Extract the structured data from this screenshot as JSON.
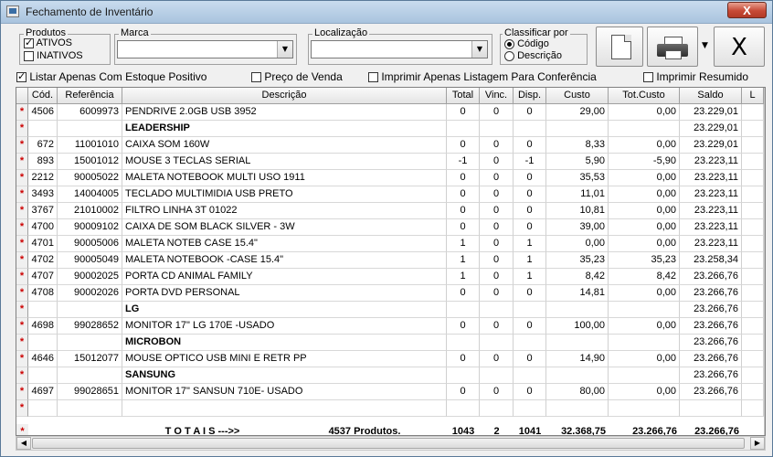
{
  "window": {
    "title": "Fechamento de Inventário",
    "close_label": "X"
  },
  "produtos": {
    "legend": "Produtos",
    "ativos_label": "ATIVOS",
    "ativos_checked": true,
    "inativos_label": "INATIVOS",
    "inativos_checked": false
  },
  "marca": {
    "legend": "Marca",
    "value": ""
  },
  "localizacao": {
    "legend": "Localização",
    "value": ""
  },
  "classificar": {
    "legend": "Classificar por",
    "codigo_label": "Código",
    "descricao_label": "Descrição",
    "selected": "codigo"
  },
  "toolbar": {
    "close_label": "X"
  },
  "options": {
    "estoque_positivo": {
      "label": "Listar Apenas Com Estoque Positivo",
      "checked": true
    },
    "preco_venda": {
      "label": "Preço de Venda",
      "checked": false
    },
    "imprimir_conferencia": {
      "label": "Imprimir Apenas Listagem Para Conferência",
      "checked": false
    },
    "imprimir_resumido": {
      "label": "Imprimir Resumido",
      "checked": false
    }
  },
  "grid": {
    "columns": [
      "Cód.",
      "Referência",
      "Descrição",
      "Total",
      "Vinc.",
      "Disp.",
      "Custo",
      "Tot.Custo",
      "Saldo",
      "L"
    ],
    "rows": [
      {
        "ind": "*",
        "cod": "4506",
        "ref": "6009973",
        "desc": "PENDRIVE 2.0GB    USB    3952",
        "total": "0",
        "vinc": "0",
        "disp": "0",
        "custo": "29,00",
        "tot": "0,00",
        "saldo": "23.229,01",
        "bold": false
      },
      {
        "ind": "*",
        "cod": "",
        "ref": "",
        "desc": "LEADERSHIP",
        "total": "",
        "vinc": "",
        "disp": "",
        "custo": "",
        "tot": "",
        "saldo": "23.229,01",
        "bold": true
      },
      {
        "ind": "*",
        "cod": "672",
        "ref": "11001010",
        "desc": "CAIXA SOM 160W",
        "total": "0",
        "vinc": "0",
        "disp": "0",
        "custo": "8,33",
        "tot": "0,00",
        "saldo": "23.229,01",
        "bold": false
      },
      {
        "ind": "*",
        "cod": "893",
        "ref": "15001012",
        "desc": "MOUSE 3 TECLAS SERIAL",
        "total": "-1",
        "vinc": "0",
        "disp": "-1",
        "custo": "5,90",
        "tot": "-5,90",
        "saldo": "23.223,11",
        "bold": false
      },
      {
        "ind": "*",
        "cod": "2212",
        "ref": "90005022",
        "desc": "MALETA NOTEBOOK MULTI USO 1911",
        "total": "0",
        "vinc": "0",
        "disp": "0",
        "custo": "35,53",
        "tot": "0,00",
        "saldo": "23.223,11",
        "bold": false
      },
      {
        "ind": "*",
        "cod": "3493",
        "ref": "14004005",
        "desc": "TECLADO MULTIMIDIA USB PRETO",
        "total": "0",
        "vinc": "0",
        "disp": "0",
        "custo": "11,01",
        "tot": "0,00",
        "saldo": "23.223,11",
        "bold": false
      },
      {
        "ind": "*",
        "cod": "3767",
        "ref": "21010002",
        "desc": "FILTRO LINHA 3T            01022",
        "total": "0",
        "vinc": "0",
        "disp": "0",
        "custo": "10,81",
        "tot": "0,00",
        "saldo": "23.223,11",
        "bold": false
      },
      {
        "ind": "*",
        "cod": "4700",
        "ref": "90009102",
        "desc": "CAIXA DE SOM BLACK SILVER - 3W",
        "total": "0",
        "vinc": "0",
        "disp": "0",
        "custo": "39,00",
        "tot": "0,00",
        "saldo": "23.223,11",
        "bold": false
      },
      {
        "ind": "*",
        "cod": "4701",
        "ref": "90005006",
        "desc": "MALETA NOTEB  CASE 15.4\"",
        "total": "1",
        "vinc": "0",
        "disp": "1",
        "custo": "0,00",
        "tot": "0,00",
        "saldo": "23.223,11",
        "bold": false
      },
      {
        "ind": "*",
        "cod": "4702",
        "ref": "90005049",
        "desc": "MALETA NOTEBOOK -CASE 15.4\"",
        "total": "1",
        "vinc": "0",
        "disp": "1",
        "custo": "35,23",
        "tot": "35,23",
        "saldo": "23.258,34",
        "bold": false
      },
      {
        "ind": "*",
        "cod": "4707",
        "ref": "90002025",
        "desc": "PORTA CD ANIMAL FAMILY",
        "total": "1",
        "vinc": "0",
        "disp": "1",
        "custo": "8,42",
        "tot": "8,42",
        "saldo": "23.266,76",
        "bold": false
      },
      {
        "ind": "*",
        "cod": "4708",
        "ref": "90002026",
        "desc": "PORTA DVD PERSONAL",
        "total": "0",
        "vinc": "0",
        "disp": "0",
        "custo": "14,81",
        "tot": "0,00",
        "saldo": "23.266,76",
        "bold": false
      },
      {
        "ind": "*",
        "cod": "",
        "ref": "",
        "desc": "LG",
        "total": "",
        "vinc": "",
        "disp": "",
        "custo": "",
        "tot": "",
        "saldo": "23.266,76",
        "bold": true
      },
      {
        "ind": "*",
        "cod": "4698",
        "ref": "99028652",
        "desc": "MONITOR  17\"  LG 170E  -USADO",
        "total": "0",
        "vinc": "0",
        "disp": "0",
        "custo": "100,00",
        "tot": "0,00",
        "saldo": "23.266,76",
        "bold": false
      },
      {
        "ind": "*",
        "cod": "",
        "ref": "",
        "desc": "MICROBON",
        "total": "",
        "vinc": "",
        "disp": "",
        "custo": "",
        "tot": "",
        "saldo": "23.266,76",
        "bold": true
      },
      {
        "ind": "*",
        "cod": "4646",
        "ref": "15012077",
        "desc": "MOUSE OPTICO USB MINI E RETR PP",
        "total": "0",
        "vinc": "0",
        "disp": "0",
        "custo": "14,90",
        "tot": "0,00",
        "saldo": "23.266,76",
        "bold": false
      },
      {
        "ind": "*",
        "cod": "",
        "ref": "",
        "desc": "SANSUNG",
        "total": "",
        "vinc": "",
        "disp": "",
        "custo": "",
        "tot": "",
        "saldo": "23.266,76",
        "bold": true
      },
      {
        "ind": "*",
        "cod": "4697",
        "ref": "99028651",
        "desc": "MONITOR  17\"  SANSUN  710E- USADO",
        "total": "0",
        "vinc": "0",
        "disp": "0",
        "custo": "80,00",
        "tot": "0,00",
        "saldo": "23.266,76",
        "bold": false
      },
      {
        "ind": "*",
        "cod": "",
        "ref": "",
        "desc": "",
        "total": "",
        "vinc": "",
        "disp": "",
        "custo": "",
        "tot": "",
        "saldo": "",
        "bold": false
      }
    ],
    "totals": {
      "ind": "*",
      "label": "T O T A I S --->>",
      "produtos": "4537 Produtos.",
      "total": "1043",
      "vinc": "2",
      "disp": "1041",
      "custo": "32.368,75",
      "tot": "23.266,76",
      "saldo": "23.266,76"
    }
  }
}
